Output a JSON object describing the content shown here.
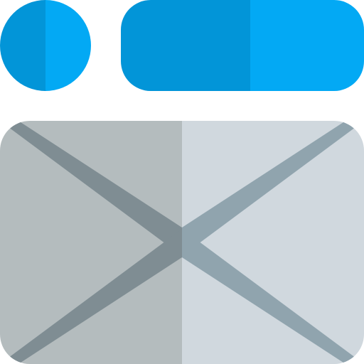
{
  "icon": {
    "name": "image-placeholder-layout-icon",
    "parts": {
      "avatar_circle": "avatar-circle",
      "title_bar": "title-bar",
      "image_placeholder": "image-placeholder"
    }
  },
  "colors": {
    "blue_light": "#03a9f4",
    "blue_dark": "#0295d8",
    "panel_left": "#b4bcbe",
    "panel_right": "#d0d8de",
    "cross_left": "#7f8d93",
    "cross_right": "#90a4ae"
  }
}
